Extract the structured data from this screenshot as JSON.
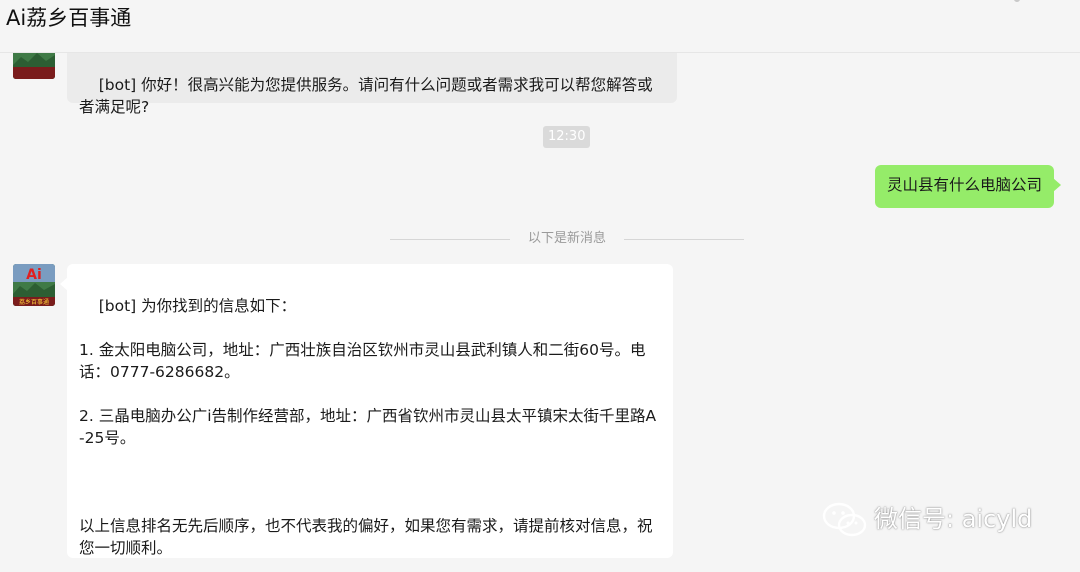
{
  "window": {
    "title": "Ai荔乡百事通"
  },
  "messages": {
    "bot_greeting": "[bot] 你好！很高兴能为您提供服务。请问有什么问题或者需求我可以帮您解答或者满足呢?",
    "timestamp": "12:30",
    "user_question": "灵山县有什么电脑公司",
    "new_messages_divider": "以下是新消息",
    "bot_answer": "[bot] 为你找到的信息如下：\n\n1. 金太阳电脑公司，地址：广西壮族自治区钦州市灵山县武利镇人和二街60号。电话：0777-6286682。\n\n2. 三晶电脑办公广i告制作经营部，地址：广西省钦州市灵山县太平镇宋太街千里路A-25号。\n\n\n\n以上信息排名无先后顺序，也不代表我的偏好，如果您有需求，请提前核对信息，祝您一切顺利。"
  },
  "avatar": {
    "label": "Ai",
    "caption": "荔乡百事通"
  },
  "watermark": {
    "text": "微信号: aicyld"
  },
  "colors": {
    "background": "#f5f5f5",
    "user_bubble": "#95ec69",
    "bot_bubble_white": "#ffffff",
    "bot_bubble_gray": "#ebebeb"
  }
}
